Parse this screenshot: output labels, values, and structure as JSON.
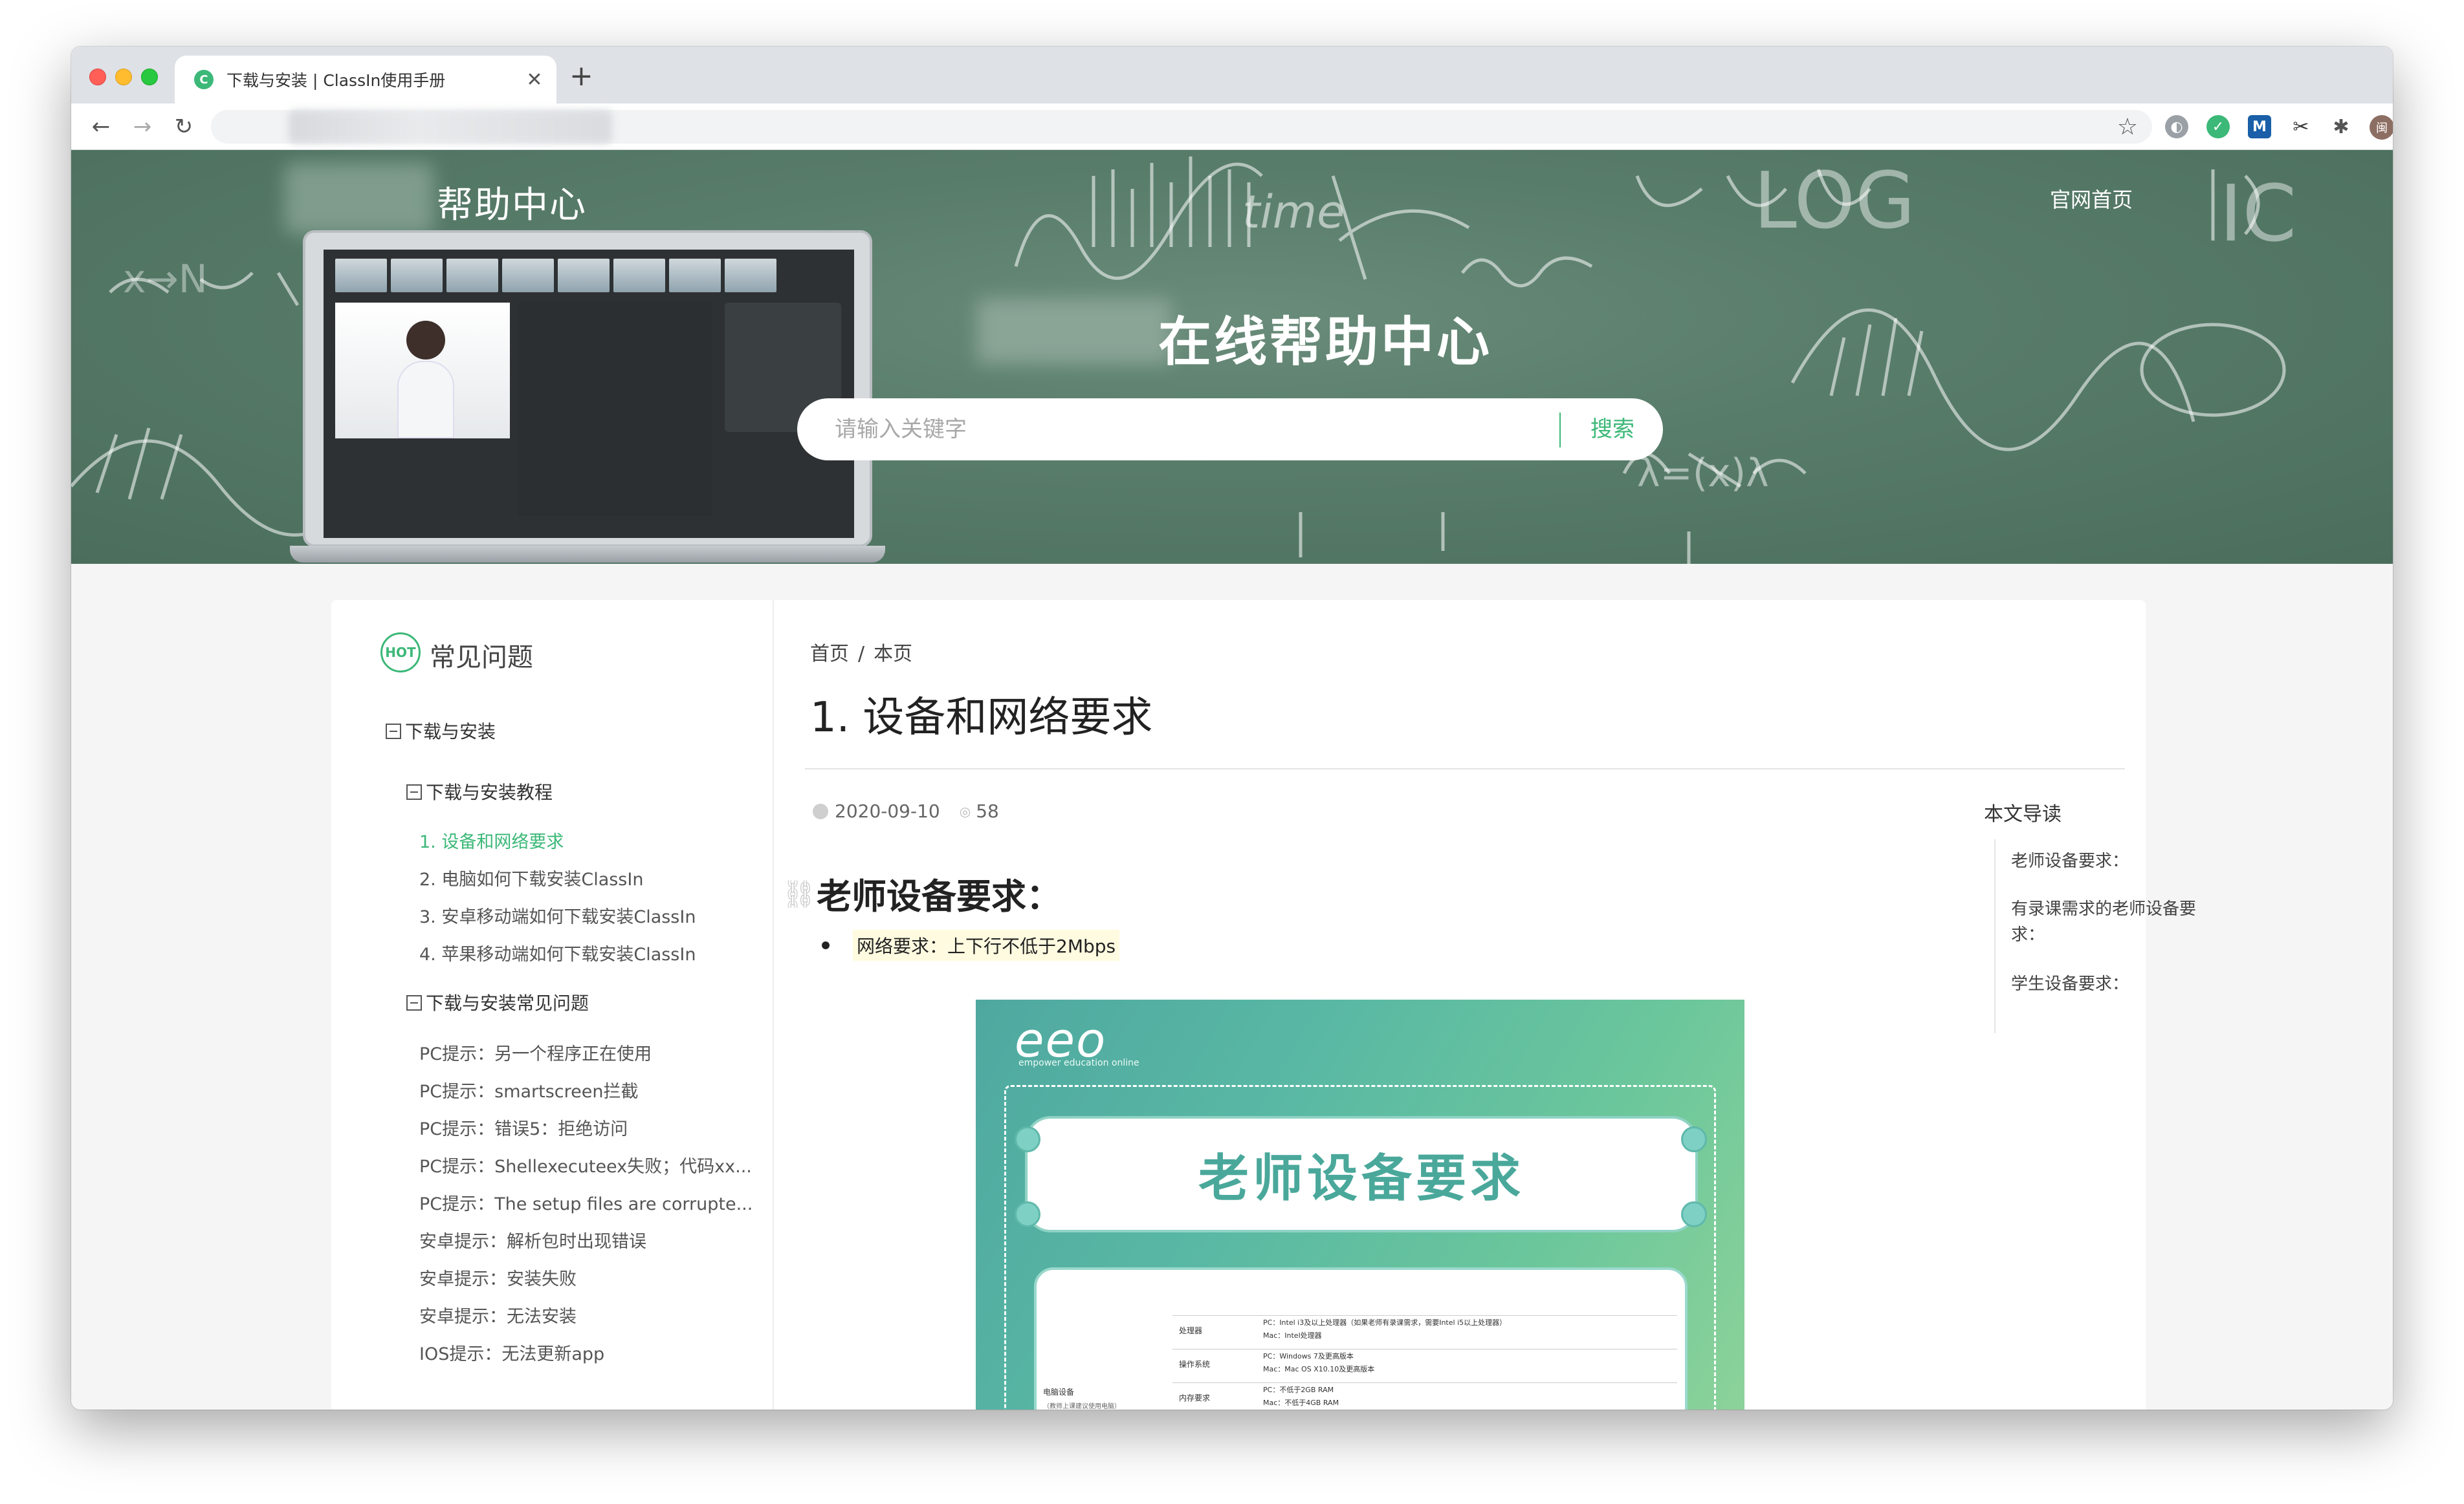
{
  "browser": {
    "tab_title": "下载与安装 | ClassIn使用手册",
    "tab_favicon": "C",
    "tab_close": "✕",
    "new_tab": "+",
    "avatar_initial": "闽"
  },
  "header": {
    "brand": "帮助中心",
    "official_link": "官网首页",
    "hero_title": "在线帮助中心",
    "search_placeholder": "请输入关键字",
    "search_button": "搜索"
  },
  "sidebar": {
    "badge": "HOT",
    "title": "常见问题",
    "section": "下载与安装",
    "groups": [
      {
        "label": "下载与安装教程",
        "items": [
          "1. 设备和网络要求",
          "2. 电脑如何下载安装ClassIn",
          "3. 安卓移动端如何下载安装ClassIn",
          "4. 苹果移动端如何下载安装ClassIn"
        ]
      },
      {
        "label": "下载与安装常见问题",
        "items": [
          "PC提示：另一个程序正在使用",
          "PC提示：smartscreen拦截",
          "PC提示：错误5：拒绝访问",
          "PC提示：Shellexecuteex失败；代码xx...",
          "PC提示：The setup files are corrupte...",
          "安卓提示：解析包时出现错误",
          "安卓提示：安装失败",
          "安卓提示：无法安装",
          "IOS提示：无法更新app"
        ]
      }
    ]
  },
  "article": {
    "breadcrumb_home": "首页",
    "breadcrumb_sep": "/",
    "breadcrumb_current": "本页",
    "title": "1. 设备和网络要求",
    "date": "2020-09-10",
    "views": "58",
    "section_heading": "老师设备要求：",
    "bullet": "网络要求：上下行不低于2Mbps",
    "poster": {
      "logo": "eeo",
      "logo_sub": "empower education online",
      "banner": "老师设备要求",
      "row_label": "电脑设备",
      "row_note": "（教师上课建议使用电脑）",
      "rows": [
        {
          "k": "处理器",
          "v1": "PC：Intel i3及以上处理器（如果老师有录课需求，需要Intel i5以上处理器）",
          "v2": "Mac：Intel处理器"
        },
        {
          "k": "操作系统",
          "v1": "PC：Windows 7及更高版本",
          "v2": "Mac：Mac OS X10.10及更高版本"
        },
        {
          "k": "内存要求",
          "v1": "PC：不低于2GB RAM",
          "v2": "Mac：不低于4GB RAM"
        }
      ]
    }
  },
  "toc": {
    "title": "本文导读",
    "items": [
      "老师设备要求：",
      "有录课需求的老师设备要求：",
      "学生设备要求："
    ]
  },
  "colors": {
    "accent": "#3cb878",
    "hero_bg": "#597d6b"
  }
}
